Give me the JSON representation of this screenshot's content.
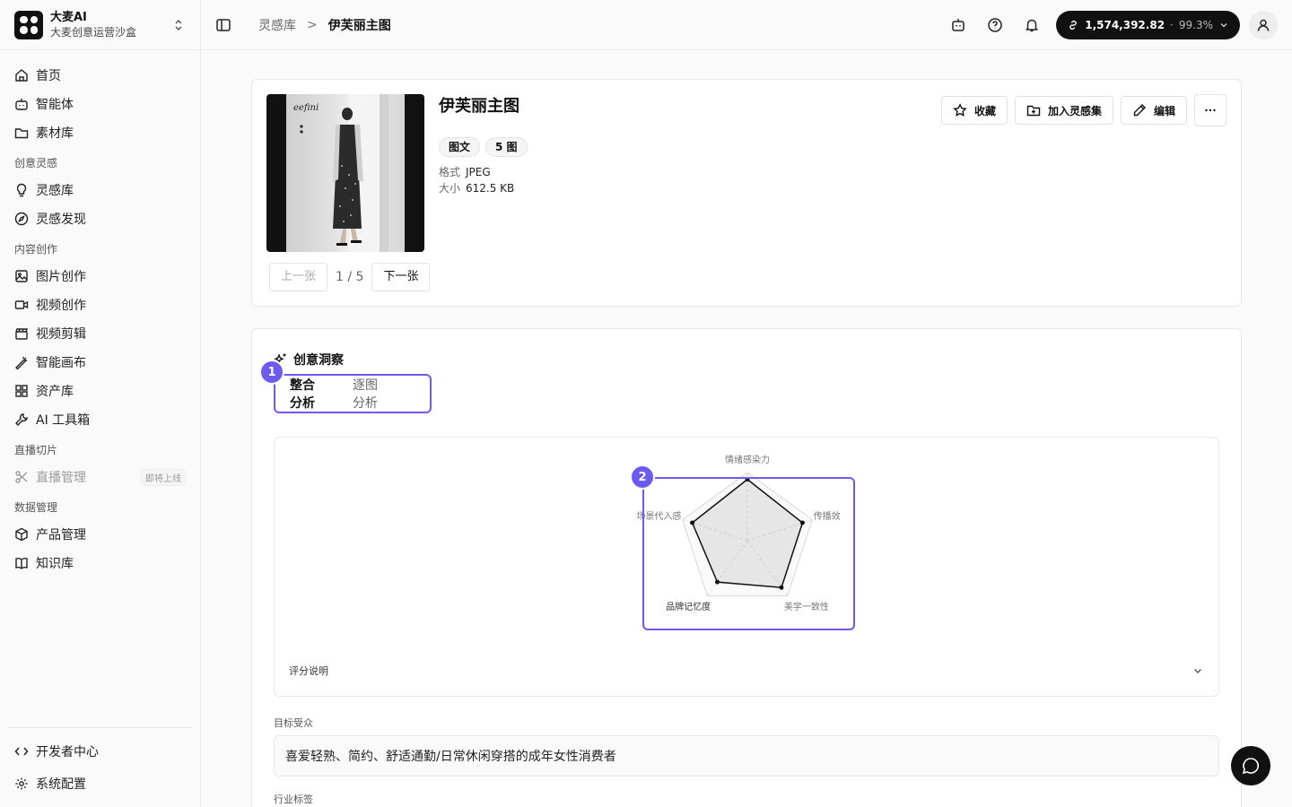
{
  "brand": {
    "title": "大麦AI",
    "subtitle": "大麦创意运营沙盒"
  },
  "nav": {
    "home": "首页",
    "agent": "智能体",
    "materials": "素材库",
    "group_inspiration": "创意灵感",
    "inspiration_lib": "灵感库",
    "inspiration_discover": "灵感发现",
    "group_content": "内容创作",
    "image_create": "图片创作",
    "video_create": "视频创作",
    "video_edit": "视频剪辑",
    "canvas": "智能画布",
    "assets": "资产库",
    "toolbox": "AI 工具箱",
    "group_live": "直播切片",
    "live_manage": "直播管理",
    "live_badge": "即将上线",
    "group_data": "数据管理",
    "product_manage": "产品管理",
    "knowledge": "知识库",
    "dev_center": "开发者中心",
    "settings": "系统配置"
  },
  "breadcrumb": {
    "parent": "灵感库",
    "separator": ">",
    "current": "伊芙丽主图"
  },
  "credits": {
    "value": "1,574,392.82",
    "dot": "·",
    "percent": "99.3%"
  },
  "asset": {
    "title": "伊芙丽主图",
    "tags": [
      "图文",
      "5 图"
    ],
    "format_label": "格式",
    "format": "JPEG",
    "size_label": "大小",
    "size": "612.5 KB",
    "prev": "上一张",
    "counter": "1 / 5",
    "next": "下一张",
    "logo_text": "eefini"
  },
  "actions": {
    "favorite": "收藏",
    "add_collection": "加入灵感集",
    "edit": "编辑"
  },
  "insight": {
    "title": "创意洞察",
    "tabs": [
      "整合分析",
      "逐图分析"
    ],
    "callout_1": "1",
    "callout_2": "2",
    "radar_axes": [
      "情绪感染力",
      "传播效",
      "美学一致性",
      "品牌记忆度",
      "场景代入感"
    ],
    "radar_values": [
      0.9,
      0.85,
      0.85,
      0.75,
      0.85
    ],
    "score_note": "评分说明",
    "audience_label": "目标受众",
    "audience": "喜爱轻熟、简约、舒适通勤/日常休闲穿搭的成年女性消费者",
    "industry_label": "行业标签"
  }
}
